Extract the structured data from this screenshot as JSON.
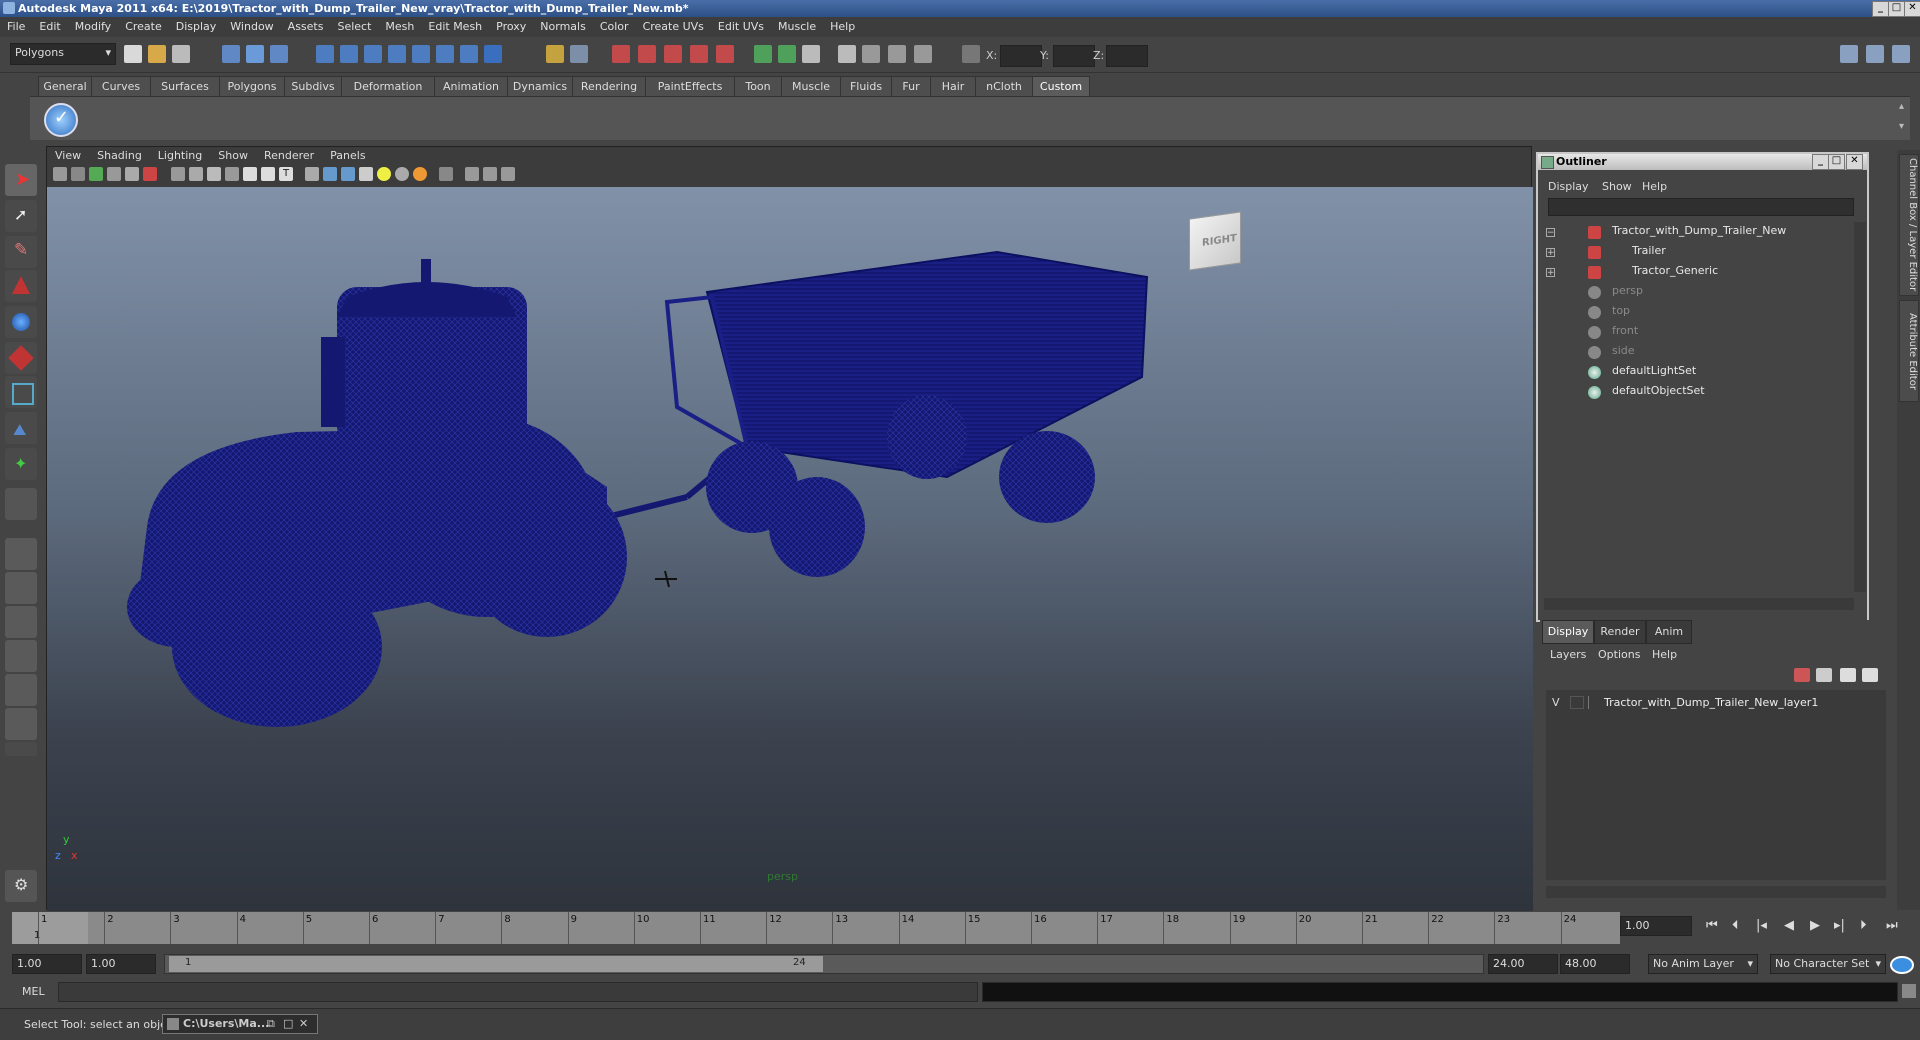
{
  "window": {
    "title": "Autodesk Maya 2011 x64: E:\\2019\\Tractor_with_Dump_Trailer_New_vray\\Tractor_with_Dump_Trailer_New.mb*"
  },
  "menubar": [
    "File",
    "Edit",
    "Modify",
    "Create",
    "Display",
    "Window",
    "Assets",
    "Select",
    "Mesh",
    "Edit Mesh",
    "Proxy",
    "Normals",
    "Color",
    "Create UVs",
    "Edit UVs",
    "Muscle",
    "Help"
  ],
  "statusline": {
    "mode": "Polygons",
    "x_label": "X:",
    "y_label": "Y:",
    "z_label": "Z:"
  },
  "shelf_tabs": [
    "General",
    "Curves",
    "Surfaces",
    "Polygons",
    "Subdivs",
    "Deformation",
    "Animation",
    "Dynamics",
    "Rendering",
    "PaintEffects",
    "Toon",
    "Muscle",
    "Fluids",
    "Fur",
    "Hair",
    "nCloth",
    "Custom"
  ],
  "shelf_active": "Custom",
  "viewport": {
    "menu": [
      "View",
      "Shading",
      "Lighting",
      "Show",
      "Renderer",
      "Panels"
    ],
    "camera_label": "persp",
    "viewcube_label": "RIGHT",
    "axis_y": "y",
    "axis_x": "x",
    "axis_z": "z"
  },
  "outliner": {
    "title": "Outliner",
    "menu": [
      "Display",
      "Show",
      "Help"
    ],
    "items": [
      {
        "label": "Tractor_with_Dump_Trailer_New",
        "dim": false
      },
      {
        "label": "Trailer",
        "dim": false
      },
      {
        "label": "Tractor_Generic",
        "dim": false
      },
      {
        "label": "persp",
        "dim": true
      },
      {
        "label": "top",
        "dim": true
      },
      {
        "label": "front",
        "dim": true
      },
      {
        "label": "side",
        "dim": true
      },
      {
        "label": "defaultLightSet",
        "dim": false
      },
      {
        "label": "defaultObjectSet",
        "dim": false
      }
    ]
  },
  "right_tabs": [
    "Channel Box / Layer Editor",
    "Attribute Editor"
  ],
  "layer_editor": {
    "tabs": [
      "Display",
      "Render",
      "Anim"
    ],
    "active_tab": "Display",
    "menu": [
      "Layers",
      "Options",
      "Help"
    ],
    "layer": {
      "visibility": "V",
      "name": "Tractor_with_Dump_Trailer_New_layer1"
    }
  },
  "timeline": {
    "ticks": [
      "1",
      "2",
      "3",
      "4",
      "5",
      "6",
      "7",
      "8",
      "9",
      "10",
      "11",
      "12",
      "13",
      "14",
      "15",
      "16",
      "17",
      "18",
      "19",
      "20",
      "21",
      "22",
      "23",
      "24"
    ],
    "current_frame": "1",
    "current_time_field": "1.00"
  },
  "range": {
    "start_field": "1.00",
    "playback_start": "1.00",
    "slider_start": "1",
    "slider_end": "24",
    "playback_end": "24.00",
    "end_field": "48.00",
    "anim_layer": "No Anim Layer",
    "character_set": "No Character Set"
  },
  "command": {
    "label": "MEL"
  },
  "helpline": {
    "text": "Select Tool: select an object",
    "taskbar_item": "C:\\Users\\Ma..."
  }
}
